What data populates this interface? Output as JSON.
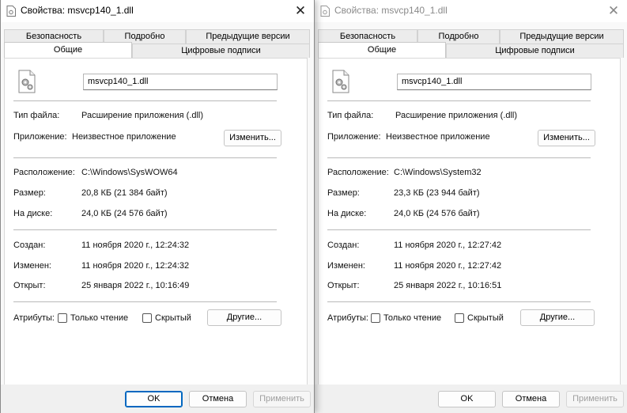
{
  "left": {
    "title": "Свойства: msvcp140_1.dll",
    "tabs_row1": [
      "Безопасность",
      "Подробно",
      "Предыдущие версии"
    ],
    "tabs_row2": [
      "Общие",
      "Цифровые подписи"
    ],
    "file_name": "msvcp140_1.dll",
    "file_type_label": "Тип файла:",
    "file_type_value": "Расширение приложения (.dll)",
    "app_label": "Приложение:",
    "app_value": "Неизвестное приложение",
    "change_button": "Изменить...",
    "location_label": "Расположение:",
    "location_value": "C:\\Windows\\SysWOW64",
    "size_label": "Размер:",
    "size_value": "20,8 КБ (21 384 байт)",
    "disk_label": "На диске:",
    "disk_value": "24,0 КБ (24 576 байт)",
    "created_label": "Создан:",
    "created_value": "11 ноября 2020 г., 12:24:32",
    "modified_label": "Изменен:",
    "modified_value": "11 ноября 2020 г., 12:24:32",
    "opened_label": "Открыт:",
    "opened_value": "25 января 2022 г., 10:16:49",
    "attributes_label": "Атрибуты:",
    "readonly_label": "Только чтение",
    "hidden_label": "Скрытый",
    "other_button": "Другие...",
    "ok_button": "OK",
    "cancel_button": "Отмена",
    "apply_button": "Применить"
  },
  "right": {
    "title": "Свойства: msvcp140_1.dll",
    "tabs_row1": [
      "Безопасность",
      "Подробно",
      "Предыдущие версии"
    ],
    "tabs_row2": [
      "Общие",
      "Цифровые подписи"
    ],
    "file_name": "msvcp140_1.dll",
    "file_type_label": "Тип файла:",
    "file_type_value": "Расширение приложения (.dll)",
    "app_label": "Приложение:",
    "app_value": "Неизвестное приложение",
    "change_button": "Изменить...",
    "location_label": "Расположение:",
    "location_value": "C:\\Windows\\System32",
    "size_label": "Размер:",
    "size_value": "23,3 КБ (23 944 байт)",
    "disk_label": "На диске:",
    "disk_value": "24,0 КБ (24 576 байт)",
    "created_label": "Создан:",
    "created_value": "11 ноября 2020 г., 12:27:42",
    "modified_label": "Изменен:",
    "modified_value": "11 ноября 2020 г., 12:27:42",
    "opened_label": "Открыт:",
    "opened_value": "25 января 2022 г., 10:16:51",
    "attributes_label": "Атрибуты:",
    "readonly_label": "Только чтение",
    "hidden_label": "Скрытый",
    "other_button": "Другие...",
    "ok_button": "OK",
    "cancel_button": "Отмена",
    "apply_button": "Применить"
  },
  "colors": {
    "accent": "#0067c0",
    "window_bg": "#f3f3f3",
    "panel_bg": "#ffffff",
    "separator": "#b9b9b9"
  },
  "icons": {
    "title": "dll-file-icon",
    "file": "gear-file-icon",
    "close": "close-icon"
  }
}
